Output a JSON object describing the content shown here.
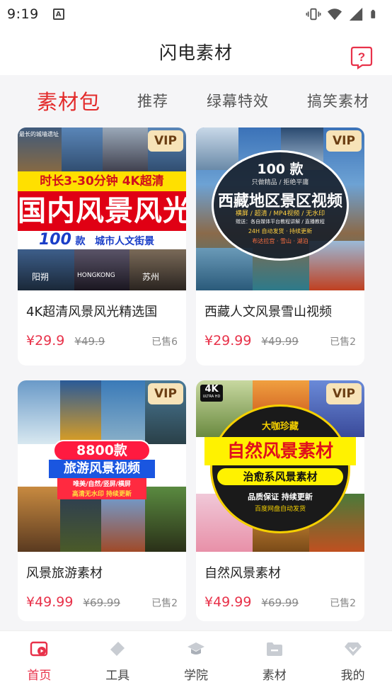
{
  "status_bar": {
    "time": "9:19",
    "notif": "A"
  },
  "header": {
    "title": "闪电素材",
    "help_icon": "help-bubble-icon"
  },
  "tabs": [
    {
      "label": "素材包",
      "active": true
    },
    {
      "label": "推荐",
      "active": false
    },
    {
      "label": "绿幕特效",
      "active": false
    },
    {
      "label": "搞笑素材",
      "active": false
    }
  ],
  "products": [
    {
      "title": "4K超清风景风光精选国",
      "price": "¥29.9",
      "original_price": "¥49.9",
      "sold": "已售6",
      "badge": "VIP",
      "image_text": {
        "top": "时长3-30分钟 4K超清",
        "main": "国内风景风光",
        "count": "100",
        "unit": "款",
        "sub": "城市人文街景",
        "corner": "最长的城墙遗址",
        "bottom1": "阳朔",
        "bottom2": "HONGKONG",
        "bottom3": "苏州"
      }
    },
    {
      "title": "西藏人文风景雪山视频",
      "price": "¥29.99",
      "original_price": "¥49.99",
      "sold": "已售2",
      "badge": "VIP",
      "image_text": {
        "count": "100 款",
        "line1": "只做精品 / 拒绝平庸",
        "main": "西藏地区景区视频",
        "tags": "横屏 / 超清 / MP4视频 / 无水印",
        "gift": "赠送：各自媒体平台教程讲解 / 直播教程",
        "send": "24H 自动发货 · 持续更新",
        "places": "布达拉宫 · 雪山 · 湖泊"
      }
    },
    {
      "title": "风景旅游素材",
      "price": "¥49.99",
      "original_price": "¥69.99",
      "sold": "已售2",
      "badge": "VIP",
      "image_text": {
        "count": "8800款",
        "main": "旅游风景视频",
        "tags": "唯美/自然/竖屏/横屏",
        "tags2": "高清无水印 持续更新"
      }
    },
    {
      "title": "自然风景素材",
      "price": "¥49.99",
      "original_price": "¥69.99",
      "sold": "已售2",
      "badge": "VIP",
      "image_text": {
        "fourk": "4K",
        "fourk_sub": "ULTRA HD",
        "top": "大咖珍藏",
        "main": "自然风景素材",
        "sub": "治愈系风景素材",
        "quality": "品质保证 持续更新",
        "send": "百度网盘自动发货"
      }
    }
  ],
  "bottom_nav": [
    {
      "label": "首页",
      "icon": "home-play-icon",
      "active": true
    },
    {
      "label": "工具",
      "icon": "eraser-tool-icon",
      "active": false
    },
    {
      "label": "学院",
      "icon": "graduation-cap-icon",
      "active": false
    },
    {
      "label": "素材",
      "icon": "folder-icon",
      "active": false
    },
    {
      "label": "我的",
      "icon": "diamond-heart-icon",
      "active": false
    }
  ],
  "colors": {
    "accent": "#e32b2b",
    "price": "#e8324a",
    "vip_bg": "#f7e3b8",
    "vip_text": "#6b3e13"
  }
}
